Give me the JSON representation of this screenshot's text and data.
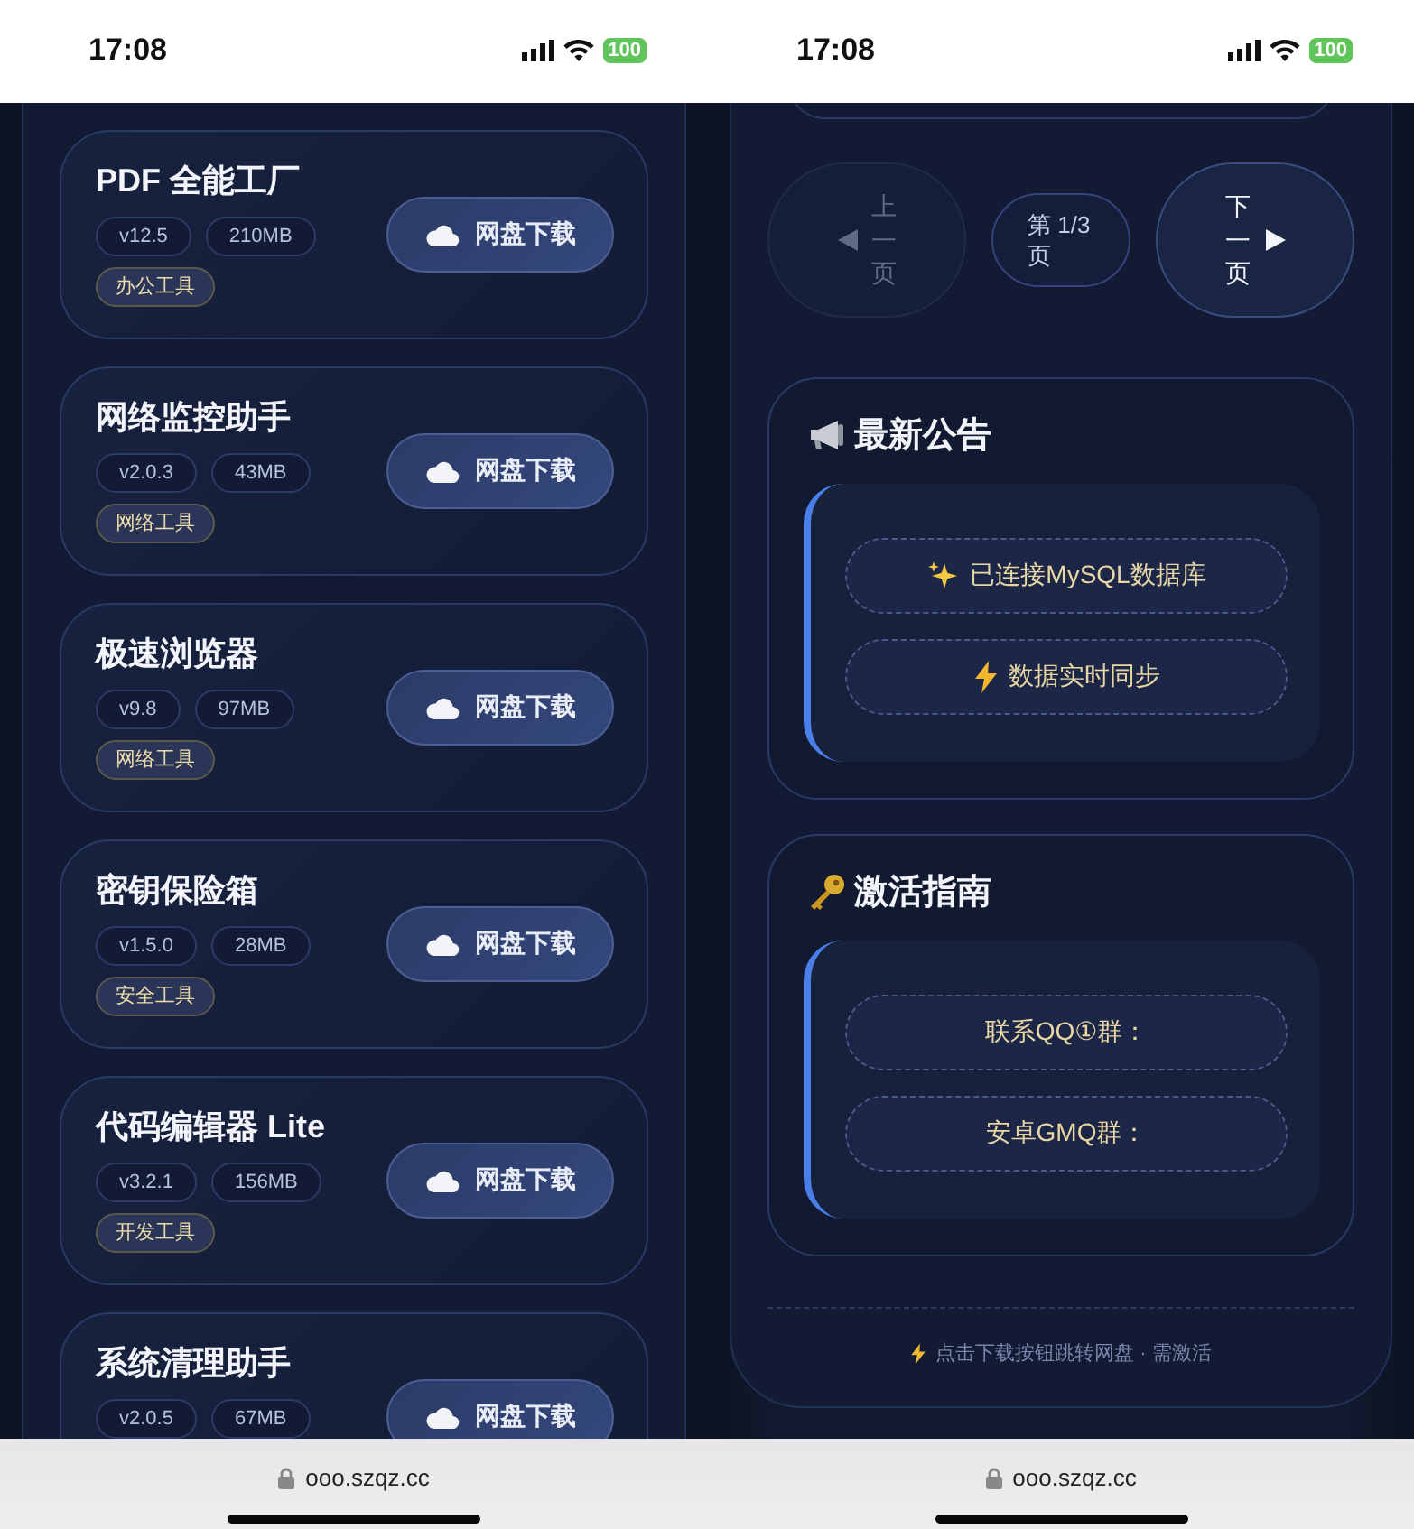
{
  "phones": [
    {
      "status_bar": {
        "time": "17:08",
        "battery": "100"
      },
      "apps": [
        {
          "name": "PDF 全能工厂",
          "version": "v12.5",
          "size": "210MB",
          "category": "办公工具",
          "button": "网盘下载"
        },
        {
          "name": "网络监控助手",
          "version": "v2.0.3",
          "size": "43MB",
          "category": "网络工具",
          "button": "网盘下载"
        },
        {
          "name": "极速浏览器",
          "version": "v9.8",
          "size": "97MB",
          "category": "网络工具",
          "button": "网盘下载"
        },
        {
          "name": "密钥保险箱",
          "version": "v1.5.0",
          "size": "28MB",
          "category": "安全工具",
          "button": "网盘下载"
        },
        {
          "name": "代码编辑器 Lite",
          "version": "v3.2.1",
          "size": "156MB",
          "category": "开发工具",
          "button": "网盘下载"
        },
        {
          "name": "系统清理助手",
          "version": "v2.0.5",
          "size": "67MB",
          "button": "网盘下载"
        }
      ],
      "browser_bar": {
        "url": "ooo.szqz.cc"
      }
    },
    {
      "status_bar": {
        "time": "17:08",
        "battery": "100"
      },
      "pagination": {
        "prev": {
          "label": "上一页",
          "disabled": true
        },
        "page": "第 1/3 页",
        "next": {
          "label": "下一页",
          "disabled": false
        }
      },
      "cards": [
        {
          "kind": "announcement",
          "title": "最新公告",
          "notes": [
            {
              "kind": "sparkle",
              "text": "已连接MySQL数据库"
            },
            {
              "kind": "bolt",
              "text": "数据实时同步"
            }
          ]
        },
        {
          "kind": "guide",
          "title": "激活指南",
          "notes": [
            {
              "kind": "plain",
              "text": "联系QQ①群："
            },
            {
              "kind": "plain",
              "text": "安卓GMQ群："
            }
          ]
        }
      ],
      "footer": {
        "kind": "bolt",
        "text": "点击下载按钮跳转网盘 · 需激活"
      },
      "browser_bar": {
        "url": "ooo.szqz.cc"
      }
    }
  ]
}
